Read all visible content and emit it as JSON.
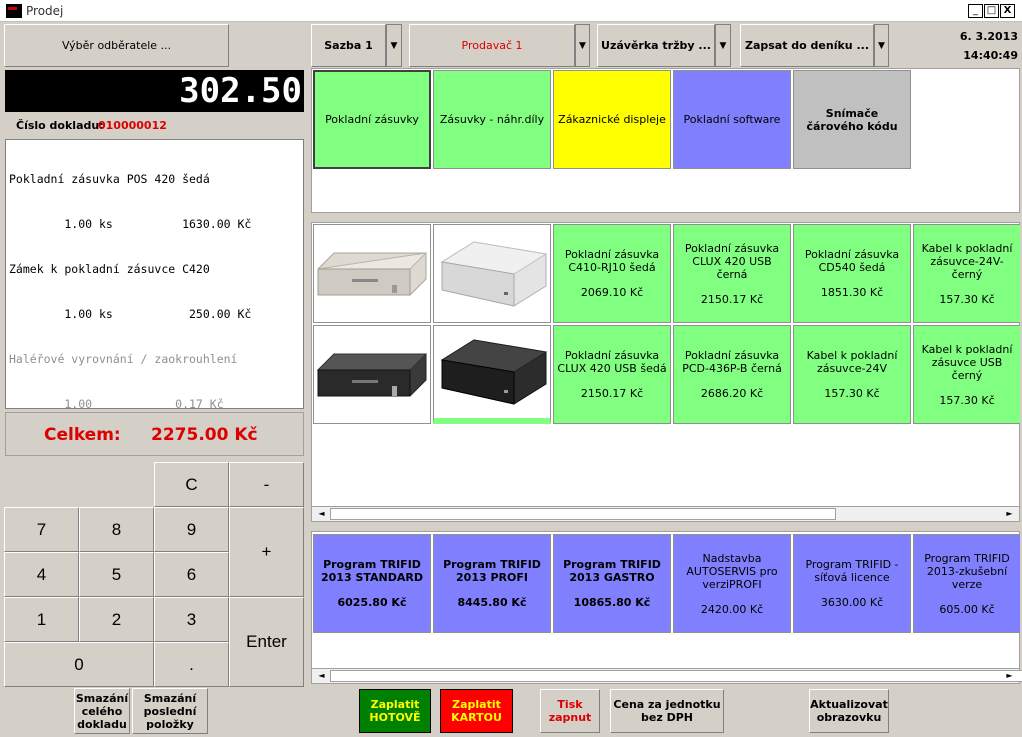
{
  "window": {
    "title": "Prodej",
    "minimize": "_",
    "maximize": "□",
    "close": "X"
  },
  "top": {
    "customer_button": "Výběr odběratele ...",
    "rate": "Sazba 1",
    "seller": "Prodavač 1",
    "closing": "Uzávěrka tržby ...",
    "journal": "Zapsat do deníku ...",
    "date": "6. 3.2013",
    "time": "14:40:49",
    "dropdown_glyph": "▼"
  },
  "display": {
    "amount": "302.50"
  },
  "document": {
    "label": "Číslo dokladu:",
    "number": "010000012"
  },
  "receipt": {
    "lines": [
      "Pokladní zásuvka POS 420 šedá",
      "        1.00 ks          1630.00 Kč",
      "Zámek k pokladní zásuvce C420",
      "        1.00 ks           250.00 Kč",
      "Haléřové vyrovnání / zaokrouhlení",
      "        1.00            0.17 Kč"
    ]
  },
  "total": {
    "label": "Celkem:",
    "value": "2275.00 Kč"
  },
  "keypad": {
    "clear": "C",
    "minus": "-",
    "plus": "+",
    "enter": "Enter",
    "dot": ".",
    "k7": "7",
    "k8": "8",
    "k9": "9",
    "k4": "4",
    "k5": "5",
    "k6": "6",
    "k1": "1",
    "k2": "2",
    "k3": "3",
    "k0": "0"
  },
  "categories": [
    {
      "label": "Pokladní zásuvky",
      "color": "#80ff80"
    },
    {
      "label": "Zásuvky - náhr.díly",
      "color": "#80ff80"
    },
    {
      "label": "Zákaznické displeje",
      "color": "#ffff00"
    },
    {
      "label": "Pokladní software",
      "color": "#8080ff"
    },
    {
      "label": "Snímače čárového kódu",
      "color": "#c0c0c0"
    }
  ],
  "products": [
    {
      "name": "Pokladní zásuvka C410-RJ10 šedá",
      "price": "2069.10 Kč"
    },
    {
      "name": "Pokladní zásuvka CLUX 420 USB černá",
      "price": "2150.17 Kč"
    },
    {
      "name": "Pokladní zásuvka CD540 šedá",
      "price": "1851.30 Kč"
    },
    {
      "name": "Kabel k pokladní zásuvce-24V-černý",
      "price": "157.30 Kč"
    },
    {
      "name": "Pokladní zásuvka CLUX 420 USB šedá",
      "price": "2150.17 Kč"
    },
    {
      "name": "Pokladní zásuvka PCD-436P-B černá",
      "price": "2686.20 Kč"
    },
    {
      "name": "Kabel k pokladní zásuvce-24V",
      "price": "157.30 Kč"
    },
    {
      "name": "Kabel k pokladní zásuvce USB černý",
      "price": "157.30 Kč"
    }
  ],
  "software": [
    {
      "name": "Program TRIFID 2013 STANDARD",
      "price": "6025.80 Kč",
      "bold": true
    },
    {
      "name": "Program TRIFID 2013 PROFI",
      "price": "8445.80 Kč",
      "bold": true
    },
    {
      "name": "Program TRIFID 2013 GASTRO",
      "price": "10865.80 Kč",
      "bold": true
    },
    {
      "name": "Nadstavba AUTOSERVIS pro verziPROFI",
      "price": "2420.00 Kč",
      "bold": false
    },
    {
      "name": "Program TRIFID - síťová licence",
      "price": "3630.00 Kč",
      "bold": false
    },
    {
      "name": "Program TRIFID 2013-zkušební verze",
      "price": "605.00 Kč",
      "bold": false
    }
  ],
  "bottom": {
    "delete_doc": "Smazání celého dokladu",
    "delete_item": "Smazání poslední položky",
    "pay_cash": "Zaplatit HOTOVĚ",
    "pay_card": "Zaplatit KARTOU",
    "print": "Tisk zapnut",
    "unit_price": "Cena za jednotku bez DPH",
    "refresh": "Aktualizovat obrazovku"
  },
  "scroll": {
    "left": "◄",
    "right": "►"
  },
  "colors": {
    "green": "#80ff80",
    "blue": "#8080ff",
    "yellow": "#ffff00",
    "red_text": "#dd0000"
  }
}
